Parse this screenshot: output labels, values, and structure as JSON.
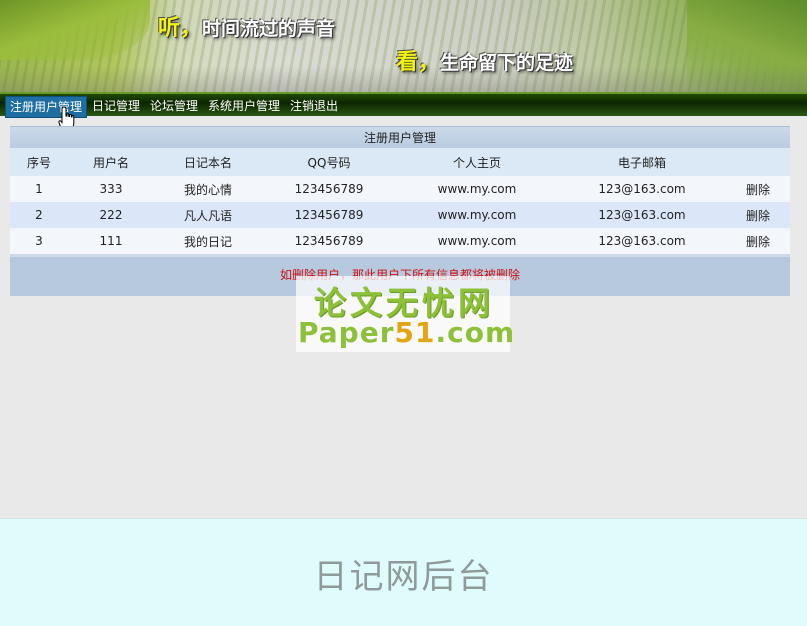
{
  "banner": {
    "slogan1_mark": "听，",
    "slogan1_text": "时间流过的声音",
    "slogan2_mark": "看，",
    "slogan2_text": "生命留下的足迹"
  },
  "nav": {
    "items": [
      {
        "label": "注册用户管理",
        "active": true
      },
      {
        "label": "日记管理",
        "active": false
      },
      {
        "label": "论坛管理",
        "active": false
      },
      {
        "label": "系统用户管理",
        "active": false
      },
      {
        "label": "注销退出",
        "active": false
      }
    ]
  },
  "panel": {
    "title": "注册用户管理",
    "columns": [
      "序号",
      "用户名",
      "日记本名",
      "QQ号码",
      "个人主页",
      "电子邮箱",
      ""
    ],
    "rows": [
      {
        "no": "1",
        "username": "333",
        "diary": "我的心情",
        "qq": "123456789",
        "homepage": "www.my.com",
        "email": "123@163.com",
        "action": "删除"
      },
      {
        "no": "2",
        "username": "222",
        "diary": "凡人凡语",
        "qq": "123456789",
        "homepage": "www.my.com",
        "email": "123@163.com",
        "action": "删除"
      },
      {
        "no": "3",
        "username": "111",
        "diary": "我的日记",
        "qq": "123456789",
        "homepage": "www.my.com",
        "email": "123@163.com",
        "action": "删除"
      }
    ],
    "note": "如删除用户，那此用户下所有信息都将被删除"
  },
  "watermark": {
    "cn": "论文无忧网",
    "en_prefix": "Paper",
    "en_num": "51",
    "en_suffix": ".com"
  },
  "footer": {
    "title": "日记网后台"
  },
  "colors": {
    "nav_active": "#1e6ea1",
    "note_text": "#cc1111",
    "footer_bg": "#dffbfb"
  }
}
